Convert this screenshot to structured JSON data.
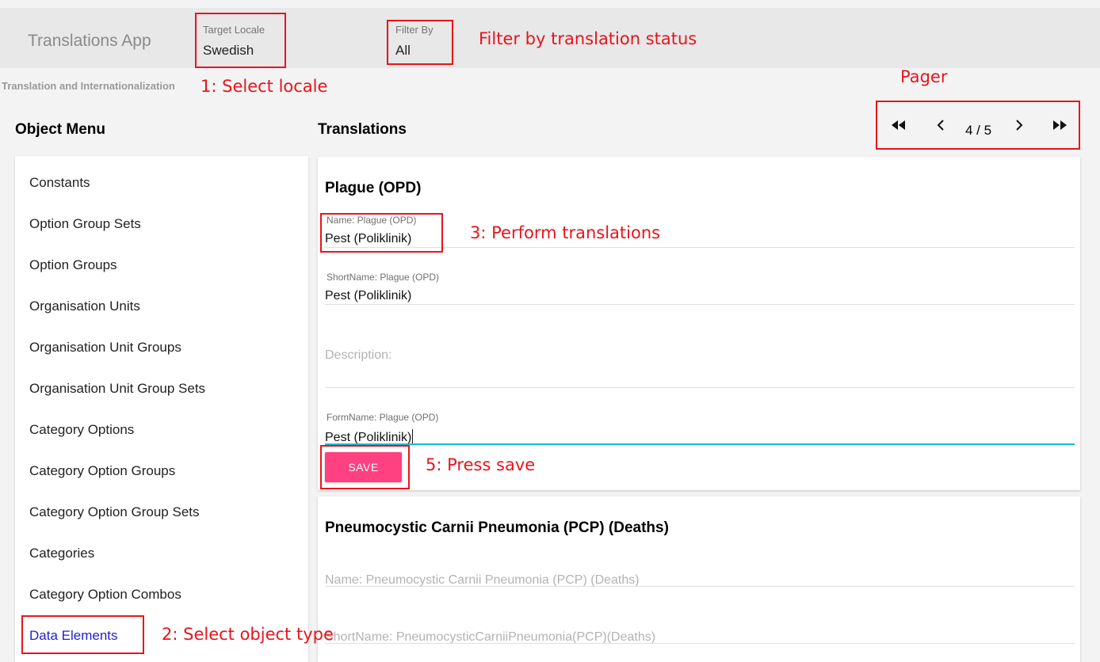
{
  "header": {
    "app_title": "Translations App",
    "target_locale": {
      "label": "Target Locale",
      "value": "Swedish"
    },
    "filter_by": {
      "label": "Filter By",
      "value": "All"
    }
  },
  "subtitle": "Translation and Internationalization",
  "object_menu": {
    "title": "Object Menu",
    "items": [
      {
        "label": "Constants"
      },
      {
        "label": "Option Group Sets"
      },
      {
        "label": "Option Groups"
      },
      {
        "label": "Organisation Units"
      },
      {
        "label": "Organisation Unit Groups"
      },
      {
        "label": "Organisation Unit Group Sets"
      },
      {
        "label": "Category Options"
      },
      {
        "label": "Category Option Groups"
      },
      {
        "label": "Category Option Group Sets"
      },
      {
        "label": "Categories"
      },
      {
        "label": "Category Option Combos"
      },
      {
        "label": "Data Elements"
      }
    ],
    "active_item": "Data Elements"
  },
  "translations": {
    "title": "Translations",
    "pager": {
      "label": "4 / 5",
      "current_page": 4,
      "total_pages": 5
    },
    "cards": [
      {
        "title": "Plague (OPD)",
        "fields": {
          "name": {
            "label": "Name: Plague (OPD)",
            "value": "Pest (Poliklinik)"
          },
          "short_name": {
            "label": "ShortName: Plague (OPD)",
            "value": "Pest (Poliklinik)"
          },
          "description": {
            "placeholder": "Description:"
          },
          "form_name": {
            "label": "FormName: Plague (OPD)",
            "value": "Pest (Poliklinik)"
          }
        },
        "save_label": "SAVE"
      },
      {
        "title": "Pneumocystic Carnii Pneumonia (PCP) (Deaths)",
        "fields": {
          "name": {
            "placeholder": "Name: Pneumocystic Carnii Pneumonia (PCP) (Deaths)"
          },
          "short_name": {
            "placeholder": "ShortName: PneumocysticCarniiPneumonia(PCP)(Deaths)"
          }
        }
      }
    ]
  },
  "annotations": {
    "filter_status": "Filter by translation status",
    "select_locale": "1: Select locale",
    "pager": "Pager",
    "perform_translations": "3: Perform translations",
    "press_save": "5: Press save",
    "select_object_type": "2: Select object type"
  },
  "colors": {
    "annotation": "#e8141c",
    "save_button": "#ff4081",
    "active_menu_item": "#1f1fd6",
    "focused_underline": "#1fb8d0"
  }
}
